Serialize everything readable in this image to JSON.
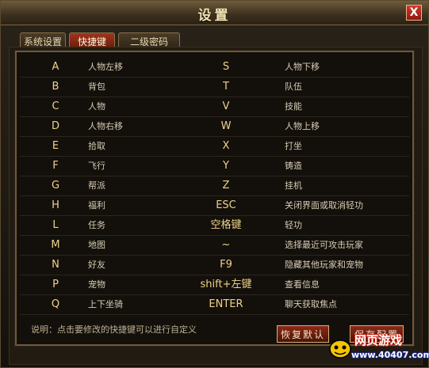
{
  "window": {
    "title": "设置",
    "close": "X"
  },
  "tabs": [
    "系统设置",
    "快捷键",
    "二级密码"
  ],
  "rows": [
    {
      "k1": "A",
      "a1": "人物左移",
      "k2": "S",
      "a2": "人物下移"
    },
    {
      "k1": "B",
      "a1": "背包",
      "k2": "T",
      "a2": "队伍"
    },
    {
      "k1": "C",
      "a1": "人物",
      "k2": "V",
      "a2": "技能"
    },
    {
      "k1": "D",
      "a1": "人物右移",
      "k2": "W",
      "a2": "人物上移"
    },
    {
      "k1": "E",
      "a1": "拾取",
      "k2": "X",
      "a2": "打坐"
    },
    {
      "k1": "F",
      "a1": "飞行",
      "k2": "Y",
      "a2": "铸造"
    },
    {
      "k1": "G",
      "a1": "帮派",
      "k2": "Z",
      "a2": "挂机"
    },
    {
      "k1": "H",
      "a1": "福利",
      "k2": "ESC",
      "a2": "关闭界面或取消轻功"
    },
    {
      "k1": "L",
      "a1": "任务",
      "k2": "空格键",
      "a2": "轻功"
    },
    {
      "k1": "M",
      "a1": "地图",
      "k2": "~",
      "a2": "选择最近可攻击玩家"
    },
    {
      "k1": "N",
      "a1": "好友",
      "k2": "F9",
      "a2": "隐藏其他玩家和宠物"
    },
    {
      "k1": "P",
      "a1": "宠物",
      "k2": "shift+左键",
      "a2": "查看信息"
    },
    {
      "k1": "Q",
      "a1": "上下坐骑",
      "k2": "ENTER",
      "a2": "聊天获取焦点"
    }
  ],
  "footer": {
    "note": "说明：点击要修改的快捷键可以进行自定义",
    "restore_default": "恢复默认",
    "save_config": "保存配置"
  },
  "watermark": {
    "brand": "网页游戏",
    "url": "www.40407.com"
  }
}
